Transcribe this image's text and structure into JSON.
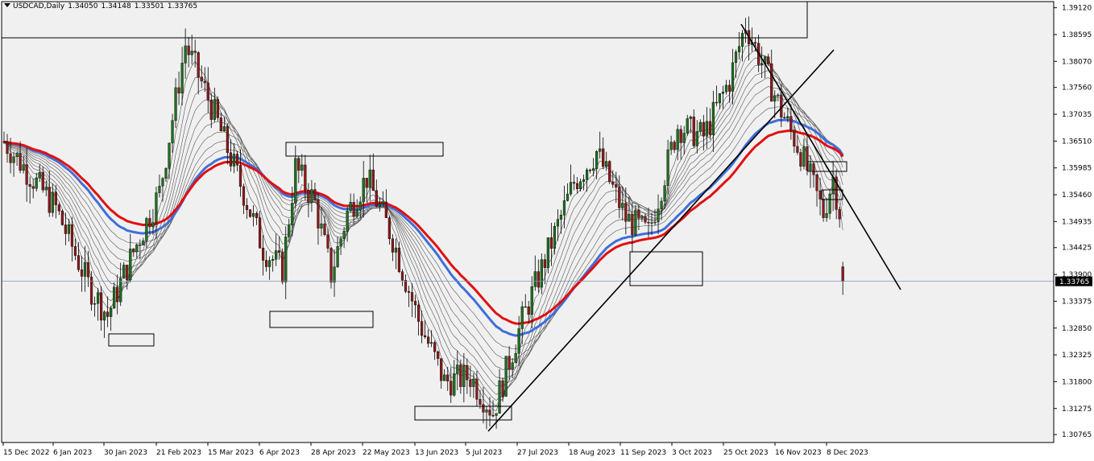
{
  "header": {
    "symbol": "USDCAD,Daily",
    "open": "1.34050",
    "high": "1.34148",
    "low": "1.33501",
    "close": "1.33765"
  },
  "colors": {
    "background": "#f0f0f0",
    "axis_bg": "#ffffff",
    "grid_line": "#000000",
    "bull_candle": "#1f6f1f",
    "bear_candle": "#8b1a1a",
    "ema_blue": "#3f6fd8",
    "ema_red": "#e01010",
    "ribbon": "#555555",
    "price_line": "#7a97b8",
    "price_tag_bg": "#000000",
    "price_tag_text": "#ffffff",
    "annotation": "#000000"
  },
  "chart_data": {
    "type": "candlestick",
    "symbol": "USDCAD",
    "timeframe": "Daily",
    "current_price": "1.33765",
    "x_tick_labels": [
      "15 Dec 2022",
      "6 Jan 2023",
      "30 Jan 2023",
      "21 Feb 2023",
      "15 Mar 2023",
      "6 Apr 2023",
      "28 Apr 2023",
      "22 May 2023",
      "13 Jun 2023",
      "5 Jul 2023",
      "27 Jul 2023",
      "18 Aug 2023",
      "11 Sep 2023",
      "3 Oct 2023",
      "25 Oct 2023",
      "16 Nov 2023",
      "8 Dec 2023"
    ],
    "y_tick_labels": [
      "1.39120",
      "1.38595",
      "1.38070",
      "1.37560",
      "1.37035",
      "1.36510",
      "1.35985",
      "1.35460",
      "1.34935",
      "1.34425",
      "1.33900",
      "1.33375",
      "1.32850",
      "1.32325",
      "1.31800",
      "1.31275",
      "1.30765"
    ],
    "ylim": [
      1.3061,
      1.3924
    ],
    "price_path_approx": [
      [
        "15 Dec 2022",
        1.365
      ],
      [
        "6 Jan 2023",
        1.352
      ],
      [
        "20 Jan 2023",
        1.337
      ],
      [
        "30 Jan 2023",
        1.331
      ],
      [
        "8 Feb 2023",
        1.342
      ],
      [
        "21 Feb 2023",
        1.355
      ],
      [
        "3 Mar 2023",
        1.384
      ],
      [
        "15 Mar 2023",
        1.372
      ],
      [
        "28 Mar 2023",
        1.355
      ],
      [
        "6 Apr 2023",
        1.344
      ],
      [
        "14 Apr 2023",
        1.34
      ],
      [
        "20 Apr 2023",
        1.36
      ],
      [
        "28 Apr 2023",
        1.353
      ],
      [
        "5 May 2023",
        1.339
      ],
      [
        "12 May 2023",
        1.351
      ],
      [
        "22 May 2023",
        1.358
      ],
      [
        "1 Jun 2023",
        1.346
      ],
      [
        "13 Jun 2023",
        1.33
      ],
      [
        "23 Jun 2023",
        1.318
      ],
      [
        "5 Jul 2023",
        1.319
      ],
      [
        "14 Jul 2023",
        1.312
      ],
      [
        "27 Jul 2023",
        1.33
      ],
      [
        "18 Aug 2023",
        1.357
      ],
      [
        "28 Aug 2023",
        1.363
      ],
      [
        "11 Sep 2023",
        1.35
      ],
      [
        "20 Sep 2023",
        1.347
      ],
      [
        "3 Oct 2023",
        1.368
      ],
      [
        "13 Oct 2023",
        1.366
      ],
      [
        "25 Oct 2023",
        1.377
      ],
      [
        "1 Nov 2023",
        1.388
      ],
      [
        "9 Nov 2023",
        1.379
      ],
      [
        "16 Nov 2023",
        1.371
      ],
      [
        "24 Nov 2023",
        1.363
      ],
      [
        "30 Nov 2023",
        1.356
      ],
      [
        "4 Dec 2023",
        1.351
      ],
      [
        "8 Dec 2023",
        1.358
      ],
      [
        "13 Dec 2023",
        1.348
      ],
      [
        "18 Dec 2023",
        1.338
      ]
    ],
    "indicators": [
      {
        "type": "moving_average",
        "color": "blue"
      },
      {
        "type": "moving_average",
        "color": "red"
      },
      {
        "type": "moving_average_ribbon",
        "color": "gray"
      }
    ]
  }
}
